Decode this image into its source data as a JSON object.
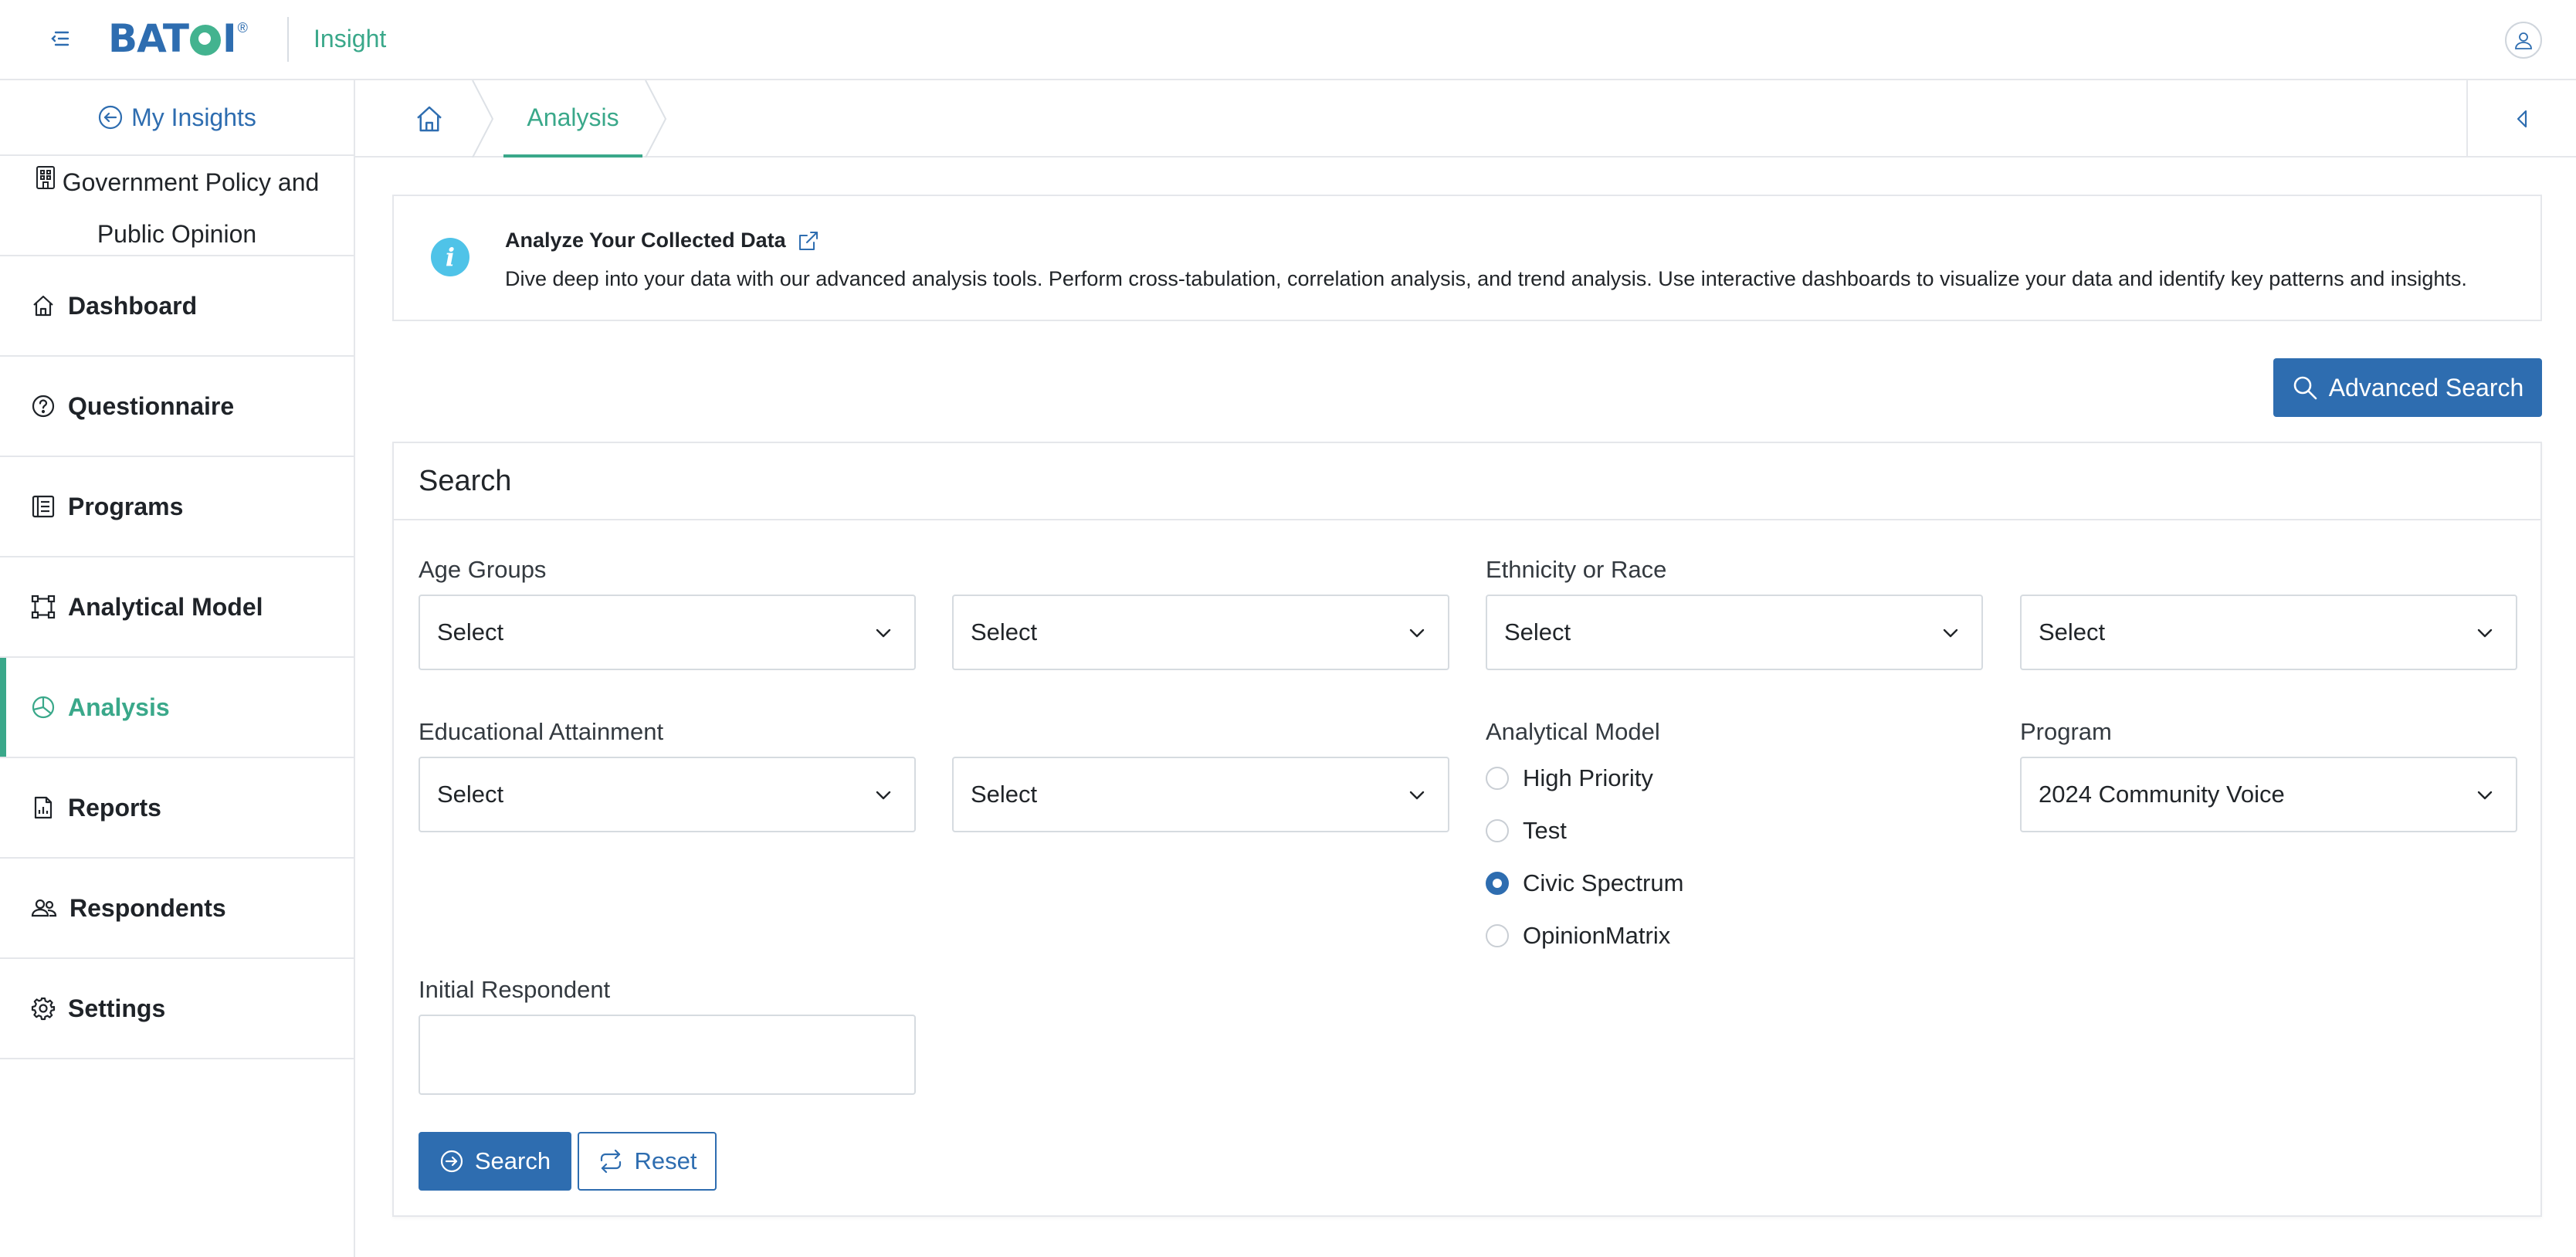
{
  "header": {
    "logo_text": "BAT",
    "logo_suffix": "I",
    "logo_reg": "®",
    "app_name": "Insight"
  },
  "sidebar": {
    "back_label": "My Insights",
    "project_line1": "Government Policy and",
    "project_line2": "Public Opinion",
    "items": [
      {
        "label": "Dashboard",
        "icon": "home-icon"
      },
      {
        "label": "Questionnaire",
        "icon": "question-circle-icon"
      },
      {
        "label": "Programs",
        "icon": "list-icon"
      },
      {
        "label": "Analytical Model",
        "icon": "bounding-box-icon"
      },
      {
        "label": "Analysis",
        "icon": "pie-chart-icon",
        "active": true
      },
      {
        "label": "Reports",
        "icon": "file-chart-icon"
      },
      {
        "label": "Respondents",
        "icon": "people-icon"
      },
      {
        "label": "Settings",
        "icon": "gear-icon"
      }
    ]
  },
  "breadcrumb": {
    "current": "Analysis"
  },
  "info": {
    "title": "Analyze Your Collected Data",
    "description": "Dive deep into your data with our advanced analysis tools. Perform cross-tabulation, correlation analysis, and trend analysis. Use interactive dashboards to visualize your data and identify key patterns and insights."
  },
  "advanced_search_label": "Advanced Search",
  "search": {
    "title": "Search",
    "age_groups_label": "Age Groups",
    "age_from": "Select",
    "age_to": "Select",
    "ethnicity_label": "Ethnicity or Race",
    "ethnicity_1": "Select",
    "ethnicity_2": "Select",
    "education_label": "Educational Attainment",
    "education_1": "Select",
    "education_2": "Select",
    "analytical_model_label": "Analytical Model",
    "analytical_models": [
      {
        "label": "High Priority",
        "checked": false
      },
      {
        "label": "Test",
        "checked": false
      },
      {
        "label": "Civic Spectrum",
        "checked": true
      },
      {
        "label": "OpinionMatrix",
        "checked": false
      }
    ],
    "program_label": "Program",
    "program_value": "2024 Community Voice",
    "initial_respondent_label": "Initial Respondent",
    "initial_respondent_value": "",
    "search_button": "Search",
    "reset_button": "Reset"
  },
  "colors": {
    "brand_blue": "#2e6db0",
    "accent_green": "#3aa88a",
    "info_blue": "#4fc3e8"
  }
}
